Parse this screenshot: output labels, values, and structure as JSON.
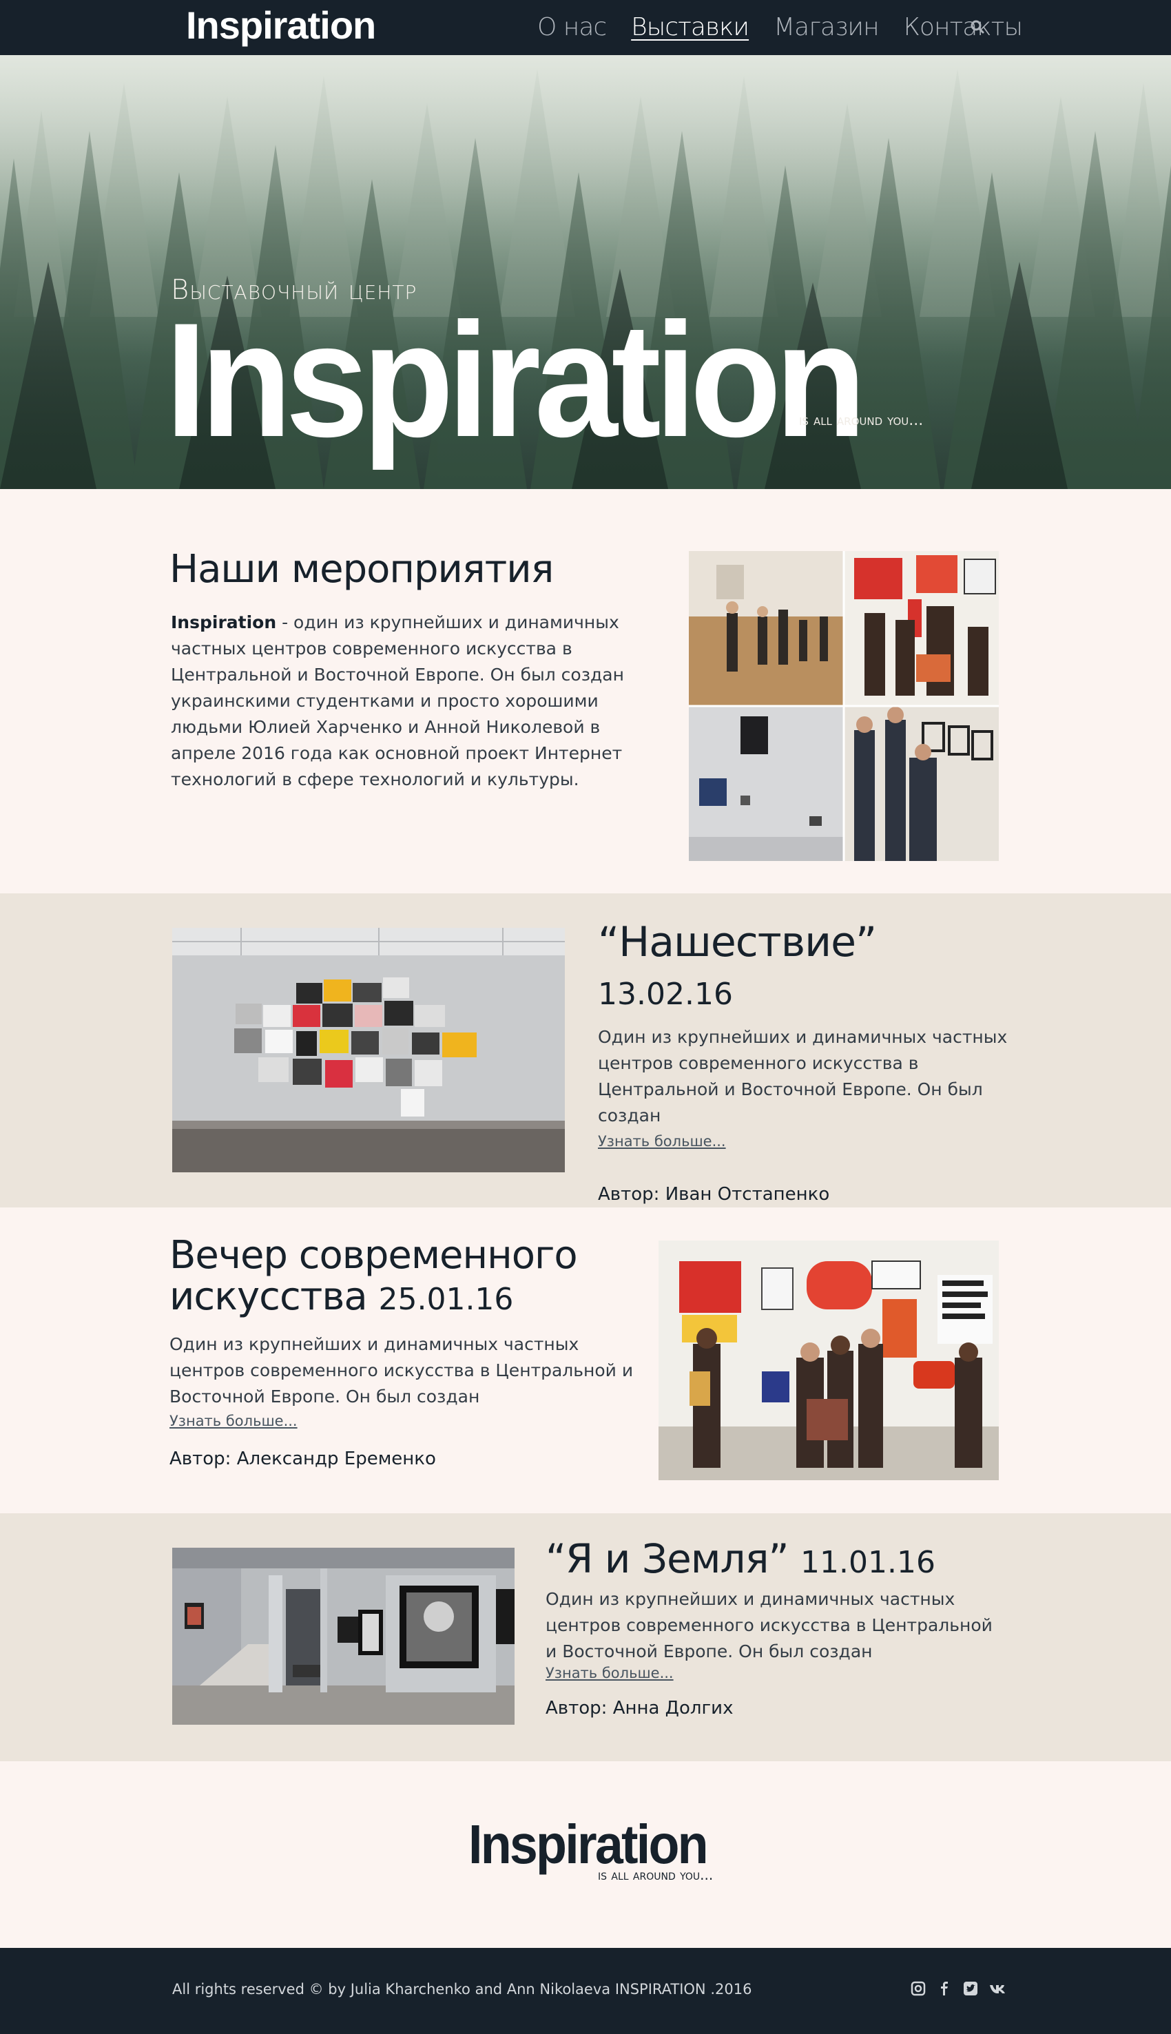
{
  "nav": {
    "logo": "Inspiration",
    "items": [
      "О нас",
      "Выставки",
      "Магазин",
      "Контакты"
    ],
    "active_item": "Выставки",
    "search_icon": "search-icon"
  },
  "hero": {
    "kicker": "Выставочный центр",
    "title": "Inspiration",
    "tagline": "is all around you..."
  },
  "about": {
    "title": "Наши мероприятия",
    "brand": "Inspiration",
    "text": " - один из крупнейших и динамичных частных центров современного искусства в Центральной и Восточной Европе. Он был создан украинскими студентками и просто хорошими людьми Юлией Харченко и Анной Николевой в апреле 2016 года как основной проект Интернет технологий в сфере технологий и культуры."
  },
  "events": [
    {
      "title": "“Нашествие”",
      "date": "13.02.16",
      "text": "Один из крупнейших и динамичных частных центров современного искусства в Центральной и Восточной Европе. Он был создан",
      "more": "Узнать больше...",
      "author": "Автор: Иван Отстапенко"
    },
    {
      "title": "Вечер современного искусства",
      "date": "25.01.16",
      "text": "Один из крупнейших и динамичных частных центров современного искусства в Центральной и Восточной Европе. Он был создан",
      "more": "Узнать больше...",
      "author": "Автор: Александр Еременко"
    },
    {
      "title": "“Я и Земля”",
      "date": "11.01.16",
      "text": "Один из крупнейших и динамичных частных центров современного искусства в Центральной и Восточной Европе. Он был создан",
      "more": "Узнать больше...",
      "author": "Автор: Анна Долгих"
    }
  ],
  "footer_logo": {
    "title": "Inspiration",
    "tagline": "is all around you..."
  },
  "footer": {
    "copyright": "All rights reserved  ©  by Julia Kharchenko and Ann Nikolaeva  INSPIRATION .2016",
    "social_icons": [
      "instagram-icon",
      "facebook-icon",
      "twitter-icon",
      "vk-icon"
    ]
  },
  "colors": {
    "nav_bg": "#17212b",
    "page_bg": "#fcf4f1",
    "alt_section_bg": "#ebe4db",
    "heading": "#17212b"
  }
}
